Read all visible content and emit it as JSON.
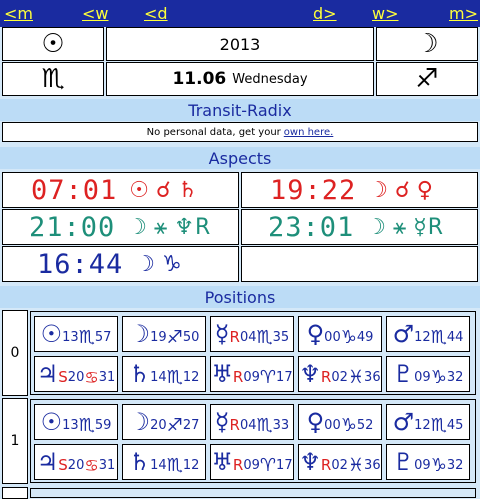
{
  "nav": {
    "m_prev": "<m",
    "w_prev": "<w",
    "d_prev": "<d",
    "d_next": "d>",
    "w_next": "w>",
    "m_next": "m>"
  },
  "header": {
    "sun_icon": "☉",
    "year": "2013",
    "moon_icon": "☽",
    "scorpio_icon": "♏",
    "date": "11.06",
    "weekday": "Wednesday",
    "sagittarius_icon": "♐"
  },
  "sections": {
    "transit_radix": "Transit-Radix",
    "aspects": "Aspects",
    "positions": "Positions"
  },
  "notice": {
    "text": "No personal data, get your ",
    "link": "own here."
  },
  "aspects": [
    {
      "time": "07:01",
      "a": "☉",
      "asp": "☌",
      "b": "♄",
      "color": "#dd2222"
    },
    {
      "time": "19:22",
      "a": "☽",
      "asp": "☌",
      "b": "♀",
      "color": "#dd2222"
    },
    {
      "time": "21:00",
      "a": "☽",
      "asp": "⚹",
      "b": "♆R",
      "color": "#1e8f7a"
    },
    {
      "time": "23:01",
      "a": "☽",
      "asp": "⚹",
      "b": "☿R",
      "color": "#1e8f7a"
    },
    {
      "time": "16:44",
      "a": "☽",
      "asp": "♑",
      "b": "",
      "color": "#1a2ba0"
    }
  ],
  "positions": [
    {
      "label": "0",
      "rows": [
        [
          {
            "planet": "☉",
            "deg": "13",
            "sign": "♏",
            "min": "57",
            "retro": ""
          },
          {
            "planet": "☽",
            "deg": "19",
            "sign": "♐",
            "min": "50",
            "retro": ""
          },
          {
            "planet": "☿",
            "deg": "04",
            "sign": "♏",
            "min": "35",
            "retro": "R"
          },
          {
            "planet": "♀",
            "deg": "00",
            "sign": "♑",
            "min": "49",
            "retro": ""
          },
          {
            "planet": "♂",
            "deg": "12",
            "sign": "♏",
            "min": "44",
            "retro": ""
          }
        ],
        [
          {
            "planet": "♃",
            "deg": "20",
            "sign": "♋",
            "min": "31",
            "retro": "S"
          },
          {
            "planet": "♄",
            "deg": "14",
            "sign": "♏",
            "min": "12",
            "retro": ""
          },
          {
            "planet": "♅",
            "deg": "09",
            "sign": "♈",
            "min": "17",
            "retro": "R"
          },
          {
            "planet": "♆",
            "deg": "02",
            "sign": "♓",
            "min": "36",
            "retro": "R"
          },
          {
            "planet": "♇",
            "deg": "09",
            "sign": "♑",
            "min": "32",
            "retro": ""
          }
        ]
      ]
    },
    {
      "label": "1",
      "rows": [
        [
          {
            "planet": "☉",
            "deg": "13",
            "sign": "♏",
            "min": "59",
            "retro": ""
          },
          {
            "planet": "☽",
            "deg": "20",
            "sign": "♐",
            "min": "27",
            "retro": ""
          },
          {
            "planet": "☿",
            "deg": "04",
            "sign": "♏",
            "min": "33",
            "retro": "R"
          },
          {
            "planet": "♀",
            "deg": "00",
            "sign": "♑",
            "min": "52",
            "retro": ""
          },
          {
            "planet": "♂",
            "deg": "12",
            "sign": "♏",
            "min": "45",
            "retro": ""
          }
        ],
        [
          {
            "planet": "♃",
            "deg": "20",
            "sign": "♋",
            "min": "31",
            "retro": "S"
          },
          {
            "planet": "♄",
            "deg": "14",
            "sign": "♏",
            "min": "12",
            "retro": ""
          },
          {
            "planet": "♅",
            "deg": "09",
            "sign": "♈",
            "min": "17",
            "retro": "R"
          },
          {
            "planet": "♆",
            "deg": "02",
            "sign": "♓",
            "min": "36",
            "retro": "R"
          },
          {
            "planet": "♇",
            "deg": "09",
            "sign": "♑",
            "min": "32",
            "retro": ""
          }
        ]
      ]
    }
  ]
}
